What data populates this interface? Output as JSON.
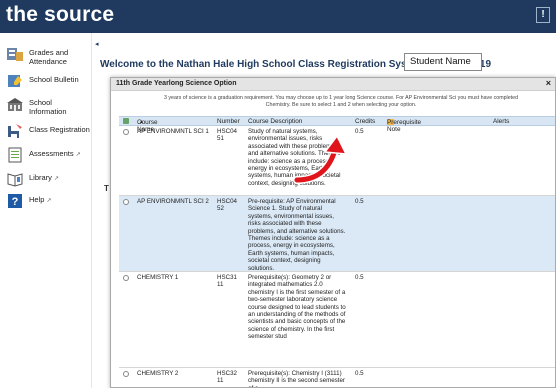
{
  "header": {
    "brand": "the source",
    "alert_label": "!"
  },
  "sidebar": {
    "items": [
      {
        "label": "Grades and Attendance",
        "icon": "gradebook-icon",
        "external": ""
      },
      {
        "label": "School Bulletin",
        "icon": "bulletin-icon",
        "external": ""
      },
      {
        "label": "School Information",
        "icon": "school-building-icon",
        "external": ""
      },
      {
        "label": "Class Registration",
        "icon": "registration-chair-icon",
        "external": ""
      },
      {
        "label": "Assessments",
        "icon": "assessment-clipboard-icon",
        "external": "↗"
      },
      {
        "label": "Library",
        "icon": "library-book-icon",
        "external": "↗"
      },
      {
        "label": "Help",
        "icon": "help-question-icon",
        "external": "↗"
      }
    ],
    "collapse_glyph": "◂"
  },
  "main": {
    "title": "Welcome to the Nathan Hale High School Class Registration System for 2018-2019",
    "student_name": "Student Name",
    "partial_letter": "T"
  },
  "modal": {
    "title": "11th Grade Yearlong Science Option",
    "close": "×",
    "instructions": "3 years of science is a graduation requirement. You may choose up to 1 year long Science course. For AP Environmental Sci you must have completed Chemistry. Be sure to select 1 and 2 when selecting your option.",
    "columns": {
      "course_name": "Course Name",
      "number": "Number",
      "description": "Course Description",
      "credits": "Credits",
      "prereq": "Prerequisite Note",
      "alerts": "Alerts"
    },
    "rows": [
      {
        "name": "AP ENVIRONMNTL SCI 1",
        "number": "HSC04 51",
        "description": "Study of natural systems, environmental issues, risks associated with these problems, and alternative solutions. Themes include: science as a process, energy in ecosystems, Earth systems, human impacts, societal context, designing solutions.",
        "credits": "0.5"
      },
      {
        "name": "AP ENVIRONMNTL SCI 2",
        "number": "HSC04 52",
        "description": "Pre-requisite: AP Environmental Science 1. Study of natural systems, environmental issues, risks associated with these problems, and alternative solutions. Themes include: science as a process, energy in ecosystems, Earth systems, human impacts, societal context, designing solutions.",
        "credits": "0.5"
      },
      {
        "name": "CHEMISTRY 1",
        "number": "HSC31 11",
        "description": "Prerequisite(s): Geometry 2 or integrated mathematics 2.0 chemistry I is the first semester of a two-semester laboratory science course designed to lead students to an understanding of the methods of scientists and basic concepts of the science of chemistry. In the first semester stud",
        "credits": "0.5"
      },
      {
        "name": "CHEMISTRY 2",
        "number": "HSC32 11",
        "description": "Prerequisite(s): Chemistry I (3111) chemistry II is the second semester of a",
        "credits": "0.5"
      }
    ]
  },
  "colors": {
    "topbar": "#1f3a5e",
    "header_row": "#d8e6f4",
    "selected_row": "#dbe9f7",
    "arrow": "#e0151b",
    "prereq_badge": "#f2b84b"
  }
}
